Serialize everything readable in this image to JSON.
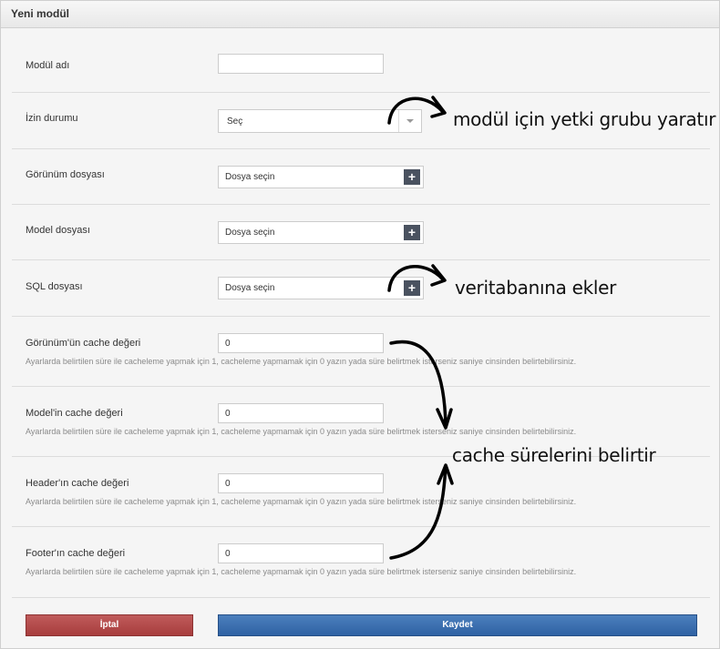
{
  "panel": {
    "title": "Yeni modül"
  },
  "form": {
    "module_name": {
      "label": "Modül adı",
      "value": ""
    },
    "permission": {
      "label": "İzin durumu",
      "selected": "Seç"
    },
    "view_file": {
      "label": "Görünüm dosyası",
      "value": "Dosya seçin"
    },
    "model_file": {
      "label": "Model dosyası",
      "value": "Dosya seçin"
    },
    "sql_file": {
      "label": "SQL dosyası",
      "value": "Dosya seçin"
    },
    "view_cache": {
      "label": "Görünüm'ün cache değeri",
      "value": "0"
    },
    "model_cache": {
      "label": "Model'in cache değeri",
      "value": "0"
    },
    "header_cache": {
      "label": "Header'ın cache değeri",
      "value": "0"
    },
    "footer_cache": {
      "label": "Footer'ın cache değeri",
      "value": "0"
    },
    "cache_help": "Ayarlarda belirtilen süre ile cacheleme yapmak için 1, cacheleme yapmamak için 0 yazın yada süre belirtmek isterseniz saniye cinsinden belirtebilirsiniz."
  },
  "buttons": {
    "cancel": "İptal",
    "save": "Kaydet"
  },
  "annotations": {
    "permission_note": "modül için yetki grubu yaratır",
    "sql_note": "veritabanına ekler",
    "cache_note": "cache sürelerini belirtir"
  },
  "colors": {
    "cancel": "#a73d3d",
    "save": "#2f62a3",
    "file_button": "#4a5260"
  }
}
